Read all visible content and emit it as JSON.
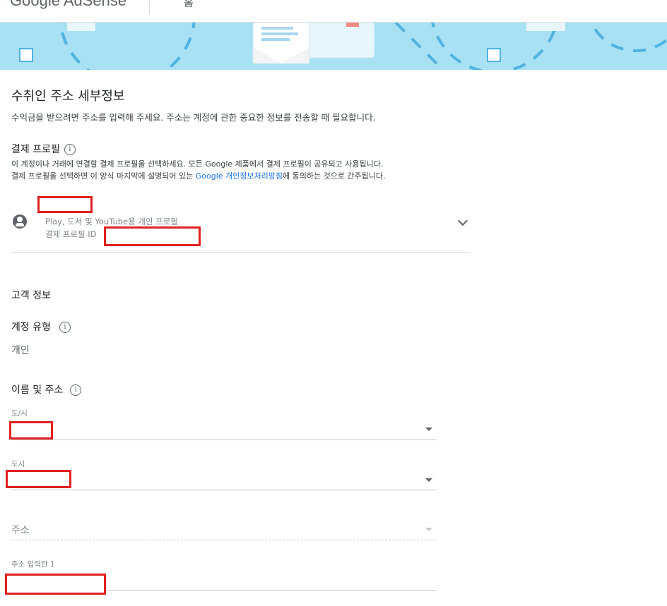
{
  "header": {
    "logo_text": "Google AdSense",
    "home_label": "홈"
  },
  "main": {
    "title": "수취인 주소 세부정보",
    "subtitle": "수익금을 받으려면 주소를 입력해 주세요. 주소는 계정에 관한 중요한 정보를 전송할 때 필요합니다."
  },
  "payment_profile": {
    "heading": "결제 프로필",
    "desc_line1": "이 계정이나 거래에 연결할 결제 프로필을 선택하세요. 모든 Google 제품에서 결제 프로필이 공유되고 사용됩니다.",
    "desc_line2_before": "결제 프로필을 선택하면 이 양식 마지막에 설명되어 있는 ",
    "desc_link": "Google 개인정보처리방침",
    "desc_line2_after": "에 동의하는 것으로 간주됩니다.",
    "profile_desc": "Play, 도서 및 YouTube용 개인 프로필",
    "profile_id_label": "결제 프로필 ID"
  },
  "customer": {
    "heading": "고객 정보",
    "account_type_label": "계정 유형",
    "account_type_value": "개인",
    "name_address_label": "이름 및 주소",
    "province_label": "도/시",
    "city_label": "도시",
    "address_placeholder": "주소",
    "address_line1_label": "주소 입력란 1"
  }
}
